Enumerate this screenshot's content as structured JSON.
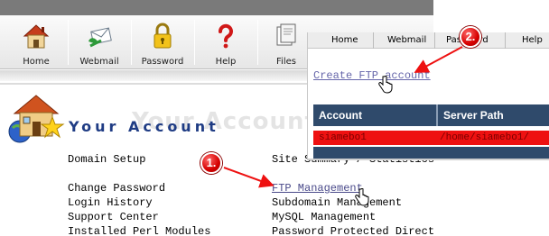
{
  "toolbar": {
    "items": [
      {
        "label": "Home",
        "icon": "house-icon"
      },
      {
        "label": "Webmail",
        "icon": "webmail-envelope-icon"
      },
      {
        "label": "Password",
        "icon": "padlock-icon"
      },
      {
        "label": "Help",
        "icon": "question-mark-icon"
      },
      {
        "label": "Files",
        "icon": "file-manager-icon"
      }
    ]
  },
  "account": {
    "watermark": "Your Account",
    "title": "Your Account"
  },
  "links": {
    "left": [
      "Domain Setup",
      "Change Password",
      "Login History",
      "Support Center",
      "Installed Perl Modules"
    ],
    "right": [
      "Site Summary / Statistics / Log",
      "FTP Management",
      "Subdomain Management",
      "MySQL Management",
      "Password Protected Directories"
    ]
  },
  "popup": {
    "nav": [
      "Home",
      "Webmail",
      "Password",
      "Help"
    ],
    "create_link": "Create FTP account",
    "table": {
      "headers": [
        "Account",
        "Server Path"
      ],
      "rows": [
        {
          "account": "siamebo1",
          "path": "/home/siamebo1/"
        }
      ]
    }
  },
  "annotations": {
    "step1": "1.",
    "step2": "2."
  },
  "colors": {
    "table_header": "#2f4a6b",
    "highlight_row": "#ee1111",
    "badge": "#d60000",
    "title_blue": "#1f3c84"
  }
}
